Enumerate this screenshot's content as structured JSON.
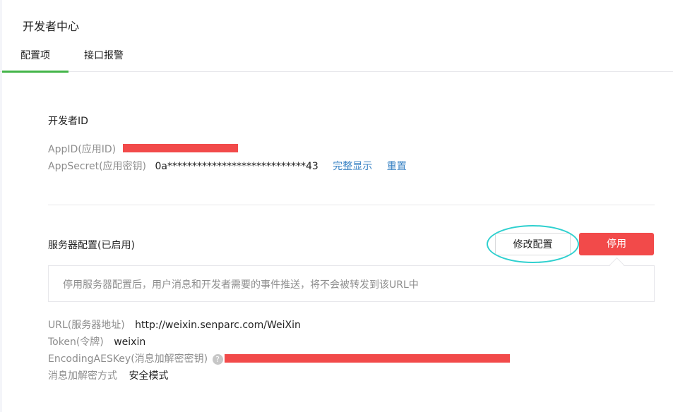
{
  "page": {
    "title": "开发者中心"
  },
  "tabs": [
    {
      "label": "配置项",
      "active": true
    },
    {
      "label": "接口报警",
      "active": false
    }
  ],
  "developer_id": {
    "section_title": "开发者ID",
    "appid_label": "AppID(应用ID)",
    "appsecret_label": "AppSecret(应用密钥)",
    "appsecret_value": "0a****************************43",
    "show_full_link": "完整显示",
    "reset_link": "重置"
  },
  "server_config": {
    "section_title": "服务器配置(已启用)",
    "edit_button": "修改配置",
    "stop_button": "停用",
    "tip": "停用服务器配置后，用户消息和开发者需要的事件推送，将不会被转发到该URL中",
    "url_label": "URL(服务器地址)",
    "url_value": "http://weixin.senparc.com/WeiXin",
    "token_label": "Token(令牌)",
    "token_value": "weixin",
    "aeskey_label": "EncodingAESKey(消息加解密密钥)",
    "help_icon_glyph": "?",
    "encrypt_mode_label": "消息加解密方式",
    "encrypt_mode_value": "安全模式"
  },
  "colors": {
    "accent_green": "#44b549",
    "danger_red": "#f24a4a",
    "link_blue": "#3a83c4",
    "highlight_cyan": "#2fd0cf"
  }
}
